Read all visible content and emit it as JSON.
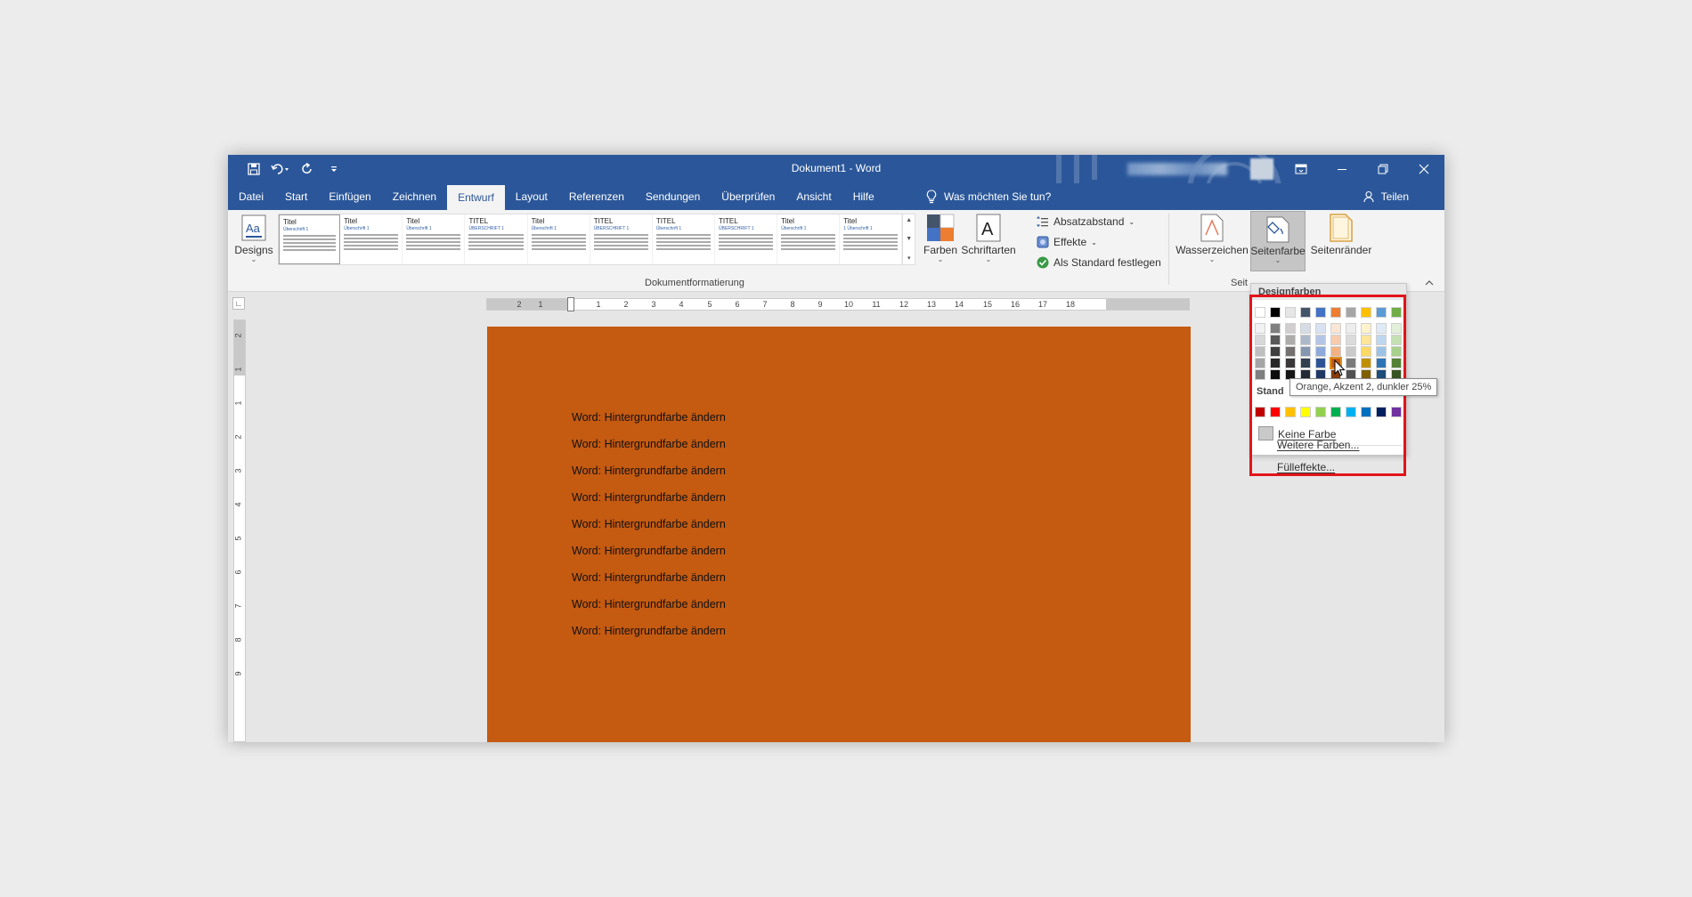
{
  "window": {
    "title": "Dokument1 - Word"
  },
  "qat": {
    "items": [
      "save-icon",
      "undo-icon",
      "redo-icon",
      "customize-icon"
    ]
  },
  "tabs": [
    {
      "label": "Datei"
    },
    {
      "label": "Start"
    },
    {
      "label": "Einfügen"
    },
    {
      "label": "Zeichnen"
    },
    {
      "label": "Entwurf",
      "active": true
    },
    {
      "label": "Layout"
    },
    {
      "label": "Referenzen"
    },
    {
      "label": "Sendungen"
    },
    {
      "label": "Überprüfen"
    },
    {
      "label": "Ansicht"
    },
    {
      "label": "Hilfe"
    }
  ],
  "tell_me": "Was möchten Sie tun?",
  "share": "Teilen",
  "ribbon": {
    "designs": "Designs",
    "gallery": [
      {
        "title": "Titel",
        "sub": "Überschrift 1"
      },
      {
        "title": "Titel",
        "sub": "Überschrift 1"
      },
      {
        "title": "Titel",
        "sub": "Überschrift 1"
      },
      {
        "title": "TITEL",
        "sub": "ÜBERSCHRIFT 1"
      },
      {
        "title": "Titel",
        "sub": "Überschrift 1"
      },
      {
        "title": "TITEL",
        "sub": "ÜBERSCHRIFT 1"
      },
      {
        "title": "TITEL",
        "sub": "Überschrift 1"
      },
      {
        "title": "TITEL",
        "sub": "ÜBERSCHRIFT 1"
      },
      {
        "title": "Titel",
        "sub": "Überschrift 1"
      },
      {
        "title": "Titel",
        "sub": "1 Überschrift 1"
      }
    ],
    "group_label": "Dokumentformatierung",
    "farben": "Farben",
    "schriftarten": "Schriftarten",
    "absatzabstand": "Absatzabstand",
    "effekte": "Effekte",
    "als_standard": "Als Standard festlegen",
    "wasserzeichen": "Wasserzeichen",
    "seitenfarbe": "Seitenfarbe",
    "seitenraender": "Seitenränder",
    "group_seite": "Seit"
  },
  "ruler": {
    "h_numbers": [
      "2",
      "1",
      "1",
      "2",
      "3",
      "4",
      "5",
      "6",
      "7",
      "8",
      "9",
      "10",
      "11",
      "12",
      "13",
      "14",
      "15",
      "16",
      "17",
      "18"
    ],
    "v_numbers": [
      "2",
      "1",
      "1",
      "2",
      "3",
      "4",
      "5",
      "6",
      "7",
      "8",
      "9"
    ]
  },
  "document": {
    "page_color": "#c55a11",
    "lines": [
      "Word: Hintergrundfarbe ändern",
      "Word: Hintergrundfarbe ändern",
      "Word: Hintergrundfarbe ändern",
      "Word: Hintergrundfarbe ändern",
      "Word: Hintergrundfarbe ändern",
      "Word: Hintergrundfarbe ändern",
      "Word: Hintergrundfarbe ändern",
      "Word: Hintergrundfarbe ändern",
      "Word: Hintergrundfarbe ändern"
    ]
  },
  "color_panel": {
    "header": "Designfarben",
    "theme_top": [
      "#ffffff",
      "#000000",
      "#e7e6e6",
      "#44546a",
      "#4472c4",
      "#ed7d31",
      "#a5a5a5",
      "#ffc000",
      "#5b9bd5",
      "#70ad47"
    ],
    "theme_shades": [
      [
        "#f2f2f2",
        "#7f7f7f",
        "#d0cece",
        "#d6dce4",
        "#d9e2f3",
        "#fbe5d5",
        "#ededed",
        "#fff2cc",
        "#deebf6",
        "#e2efd9"
      ],
      [
        "#d8d8d8",
        "#595959",
        "#aeabab",
        "#adb9ca",
        "#b4c6e7",
        "#f7cbac",
        "#dbdbdb",
        "#fee599",
        "#bdd7ee",
        "#c5e0b3"
      ],
      [
        "#bfbfbf",
        "#3f3f3f",
        "#757070",
        "#8496b0",
        "#8eaadb",
        "#f4b183",
        "#c9c9c9",
        "#ffd965",
        "#9cc3e5",
        "#a8d08d"
      ],
      [
        "#a5a5a5",
        "#262626",
        "#3a3838",
        "#323f4f",
        "#2f5496",
        "#c55a11",
        "#7b7b7b",
        "#bf9000",
        "#2e75b5",
        "#538135"
      ],
      [
        "#7f7f7f",
        "#0c0c0c",
        "#171616",
        "#222a35",
        "#1f3864",
        "#843c0b",
        "#525252",
        "#7f6000",
        "#1e4e79",
        "#375623"
      ]
    ],
    "highlighted": "#c55a11",
    "standard_label": "Stand",
    "standard_colors": [
      "#c00000",
      "#ff0000",
      "#ffc000",
      "#ffff00",
      "#92d050",
      "#00b050",
      "#00b0f0",
      "#0070c0",
      "#002060",
      "#7030a0"
    ],
    "keine_farbe": "Keine Farbe",
    "weitere_farben": "Weitere Farben...",
    "fuelleffekte": "Fülleffekte..."
  },
  "tooltip": "Orange, Akzent 2, dunkler 25%"
}
